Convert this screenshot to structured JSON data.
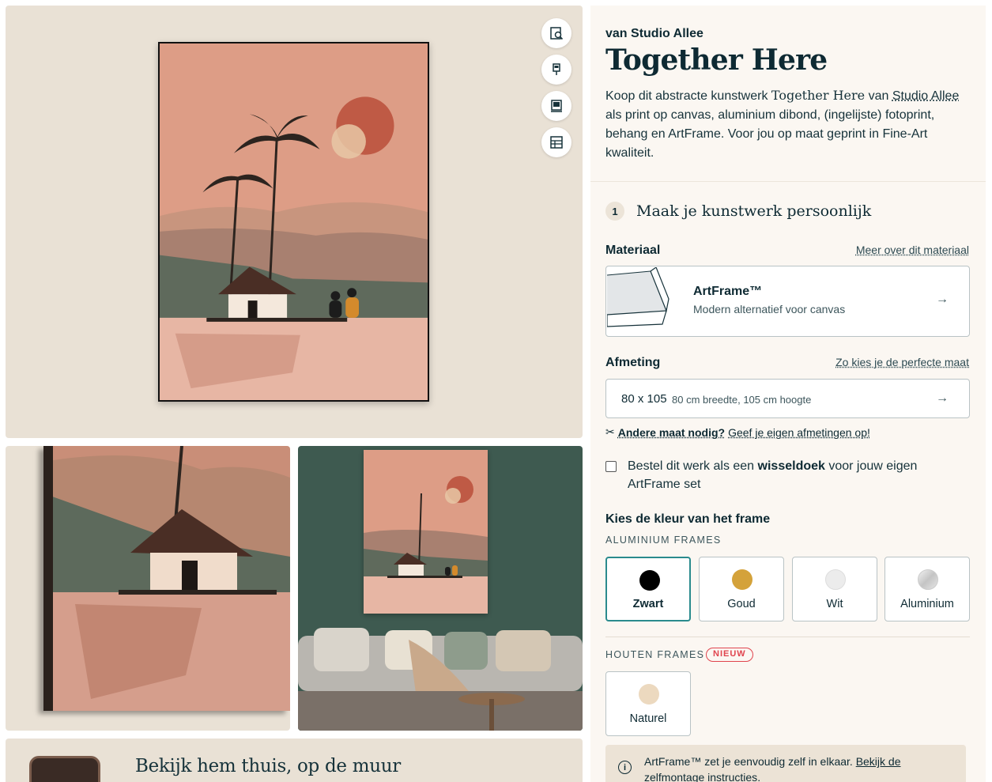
{
  "gallery": {
    "bottom_title": "Bekijk hem thuis, op de muur"
  },
  "tools": [
    "zoom-preview-icon",
    "wall-preview-icon",
    "frame-preview-icon",
    "details-icon"
  ],
  "product": {
    "artist_line": "van Studio Allee",
    "title": "Together Here",
    "desc_1": "Koop dit abstracte kunstwerk ",
    "desc_title": "Together Here",
    "desc_2": " van ",
    "desc_artist": "Studio Allee",
    "desc_3": " als print op canvas, aluminium dibond, (ingelijste) fotoprint, behang en ArtFrame. Voor jou op maat geprint in Fine-Art kwaliteit."
  },
  "step": {
    "number": "1",
    "title": "Maak je kunstwerk persoonlijk"
  },
  "material": {
    "label": "Materiaal",
    "help": "Meer over dit materiaal",
    "name": "ArtFrame™",
    "sub": "Modern alternatief voor canvas",
    "arrow": "→"
  },
  "size": {
    "label": "Afmeting",
    "help": "Zo kies je de perfecte maat",
    "value": "80 x 105",
    "detail": "80 cm breedte, 105 cm hoogte",
    "arrow": "→"
  },
  "custom_size": {
    "icon": "✂",
    "strong": "Andere maat nodig?",
    "link": "Geef je eigen afmetingen op!"
  },
  "swap_option": {
    "text_1": "Bestel dit werk als een ",
    "bold": "wisseldoek",
    "text_2": " voor jouw eigen ArtFrame set",
    "checked": false
  },
  "frames": {
    "label": "Kies de kleur van het frame",
    "aluminium_caption": "ALUMINIUM FRAMES",
    "aluminium": [
      {
        "name": "Zwart",
        "color": "#000000",
        "selected": true
      },
      {
        "name": "Goud",
        "color": "#d4a23a",
        "selected": false
      },
      {
        "name": "Wit",
        "color": "#ececec",
        "selected": false
      },
      {
        "name": "Aluminium",
        "color": "#d6d6d6",
        "selected": false
      }
    ],
    "wood_caption": "HOUTEN FRAMES",
    "wood_badge": "NIEUW",
    "wood": [
      {
        "name": "Naturel",
        "color": "#ecd9bf",
        "selected": false
      }
    ]
  },
  "info": {
    "icon": "i",
    "text": "ArtFrame™ zet je eenvoudig zelf in elkaar. ",
    "link": "Bekijk de zelfmontage instructies",
    "after": "."
  }
}
